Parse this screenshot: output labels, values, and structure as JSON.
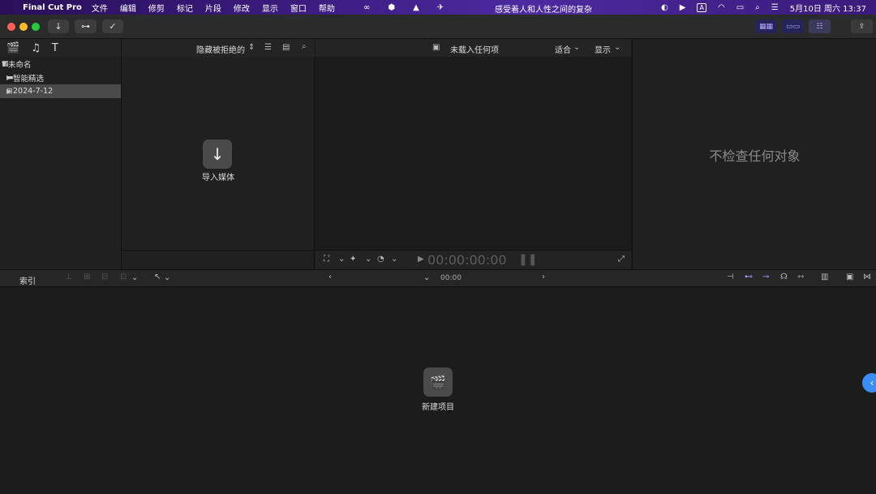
{
  "menubar": {
    "app_name": "Final Cut Pro",
    "items": [
      "文件",
      "编辑",
      "修剪",
      "标记",
      "片段",
      "修改",
      "显示",
      "窗口",
      "帮助"
    ],
    "center_title": "感受着人和人性之间的复杂",
    "date_time": "5月10日 周六 13:37",
    "input_label": "A"
  },
  "library": {
    "items": [
      {
        "label": "未命名",
        "disclosure": "▼"
      },
      {
        "label": "智能精选",
        "disclosure": "▶"
      },
      {
        "label": "2024-7-12",
        "disclosure": "▶"
      }
    ]
  },
  "browser": {
    "filter": "隐藏被拒绝的",
    "import_label": "导入媒体"
  },
  "viewer": {
    "title": "未载入任何项",
    "fit_label": "适合",
    "display_label": "显示",
    "timecode": "00:00:00:00"
  },
  "inspector": {
    "empty_text": "不检查任何对象"
  },
  "timeline": {
    "index_label": "索引",
    "timecode": "00:00",
    "new_project_label": "新建项目"
  }
}
